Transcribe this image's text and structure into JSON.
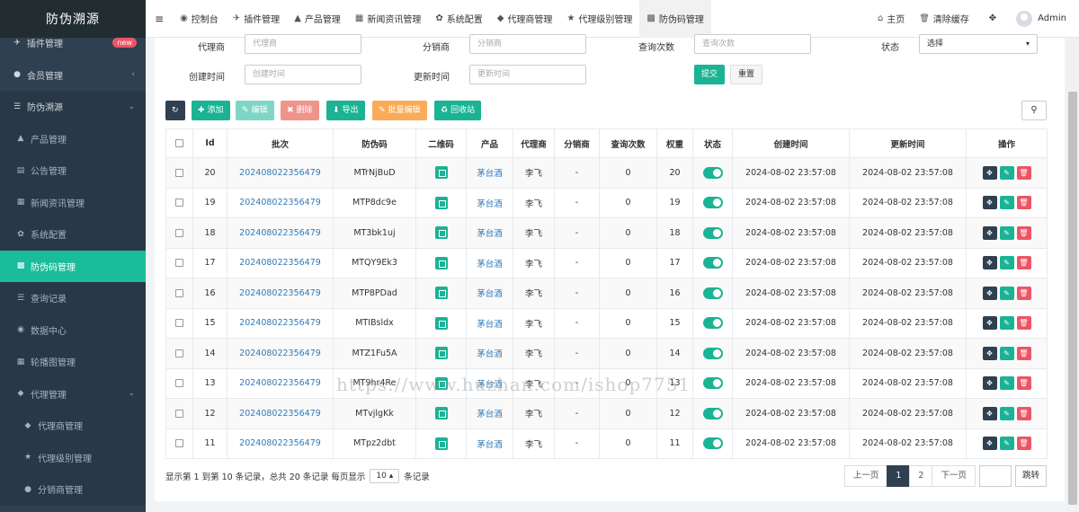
{
  "sidebar": {
    "logo": "防伪溯源",
    "items": [
      {
        "icon": "plugin-icon",
        "glyph": "✈",
        "label": "插件管理",
        "badge": "new",
        "kind": "top"
      },
      {
        "icon": "user-circle-icon",
        "glyph": "●",
        "label": "会员管理",
        "arrow": "‹",
        "kind": "top"
      },
      {
        "icon": "list-icon",
        "glyph": "☰",
        "label": "防伪溯源",
        "arrow": "⌄",
        "kind": "top-open"
      },
      {
        "icon": "building-icon",
        "glyph": "▲",
        "label": "产品管理",
        "kind": "sub"
      },
      {
        "icon": "file-icon",
        "glyph": "▤",
        "label": "公告管理",
        "kind": "sub"
      },
      {
        "icon": "newspaper-icon",
        "glyph": "▦",
        "label": "新闻资讯管理",
        "kind": "sub"
      },
      {
        "icon": "gear-icon",
        "glyph": "✿",
        "label": "系统配置",
        "kind": "sub"
      },
      {
        "icon": "barcode-icon",
        "glyph": "▩",
        "label": "防伪码管理",
        "kind": "sub-active"
      },
      {
        "icon": "list-icon",
        "glyph": "☰",
        "label": "查询记录",
        "kind": "sub"
      },
      {
        "icon": "dashboard-icon",
        "glyph": "◉",
        "label": "数据中心",
        "kind": "sub"
      },
      {
        "icon": "carousel-icon",
        "glyph": "▦",
        "label": "轮播图管理",
        "kind": "sub"
      },
      {
        "icon": "users-icon",
        "glyph": "◆",
        "label": "代理管理",
        "arrow": "⌄",
        "kind": "sub"
      },
      {
        "icon": "users-icon",
        "glyph": "◆",
        "label": "代理商管理",
        "kind": "sub2"
      },
      {
        "icon": "star-icon",
        "glyph": "★",
        "label": "代理级别管理",
        "kind": "sub2"
      },
      {
        "icon": "user-circle-icon",
        "glyph": "●",
        "label": "分销商管理",
        "kind": "sub2"
      }
    ]
  },
  "topnav": {
    "menu_icon": "≡",
    "tabs": [
      {
        "icon": "dashboard-icon",
        "glyph": "◉",
        "label": "控制台"
      },
      {
        "icon": "plugin-icon",
        "glyph": "✈",
        "label": "插件管理"
      },
      {
        "icon": "building-icon",
        "glyph": "▲",
        "label": "产品管理"
      },
      {
        "icon": "newspaper-icon",
        "glyph": "▦",
        "label": "新闻资讯管理"
      },
      {
        "icon": "gear-icon",
        "glyph": "✿",
        "label": "系统配置"
      },
      {
        "icon": "users-icon",
        "glyph": "◆",
        "label": "代理商管理"
      },
      {
        "icon": "star-icon",
        "glyph": "★",
        "label": "代理级别管理"
      },
      {
        "icon": "barcode-icon",
        "glyph": "▩",
        "label": "防伪码管理",
        "active": true
      }
    ],
    "home": {
      "glyph": "⌂",
      "label": "主页"
    },
    "clear_cache": {
      "glyph": "🗑",
      "label": "清除缓存"
    },
    "fullscreen_glyph": "✥",
    "user": "Admin"
  },
  "filters": {
    "agent": {
      "label": "代理商",
      "placeholder": "代理商"
    },
    "distributor": {
      "label": "分销商",
      "placeholder": "分销商"
    },
    "query_count": {
      "label": "查询次数",
      "placeholder": "查询次数"
    },
    "status": {
      "label": "状态",
      "value": "选择",
      "caret": "▾"
    },
    "created": {
      "label": "创建时间",
      "placeholder": "创建时间"
    },
    "updated": {
      "label": "更新时间",
      "placeholder": "更新时间"
    },
    "submit": "提交",
    "reset": "重置"
  },
  "toolbar": {
    "refresh_glyph": "↻",
    "add": "添加",
    "edit": "编辑",
    "delete": "删除",
    "export": "导出",
    "batch_edit": "批量编辑",
    "recycle": "回收站",
    "search_glyph": "⚲",
    "colors": {
      "refresh": "#2f4050",
      "add": "#1ab394",
      "edit": "#7fd6c6",
      "delete": "#f0938b",
      "export": "#1ab394",
      "batch_edit": "#f8ac59",
      "recycle": "#1ab394"
    }
  },
  "table": {
    "columns": [
      "Id",
      "批次",
      "防伪码",
      "二维码",
      "产品",
      "代理商",
      "分销商",
      "查询次数",
      "权重",
      "状态",
      "创建时间",
      "更新时间",
      "操作"
    ],
    "rows": [
      {
        "id": "20",
        "batch": "202408022356479",
        "code": "MTrNjBuD",
        "product": "茅台酒",
        "agent": "李飞",
        "distributor": "-",
        "queries": "0",
        "weight": "20",
        "created": "2024-08-02 23:57:08",
        "updated": "2024-08-02 23:57:08"
      },
      {
        "id": "19",
        "batch": "202408022356479",
        "code": "MTP8dc9e",
        "product": "茅台酒",
        "agent": "李飞",
        "distributor": "-",
        "queries": "0",
        "weight": "19",
        "created": "2024-08-02 23:57:08",
        "updated": "2024-08-02 23:57:08"
      },
      {
        "id": "18",
        "batch": "202408022356479",
        "code": "MT3bk1uj",
        "product": "茅台酒",
        "agent": "李飞",
        "distributor": "-",
        "queries": "0",
        "weight": "18",
        "created": "2024-08-02 23:57:08",
        "updated": "2024-08-02 23:57:08"
      },
      {
        "id": "17",
        "batch": "202408022356479",
        "code": "MTQY9Ek3",
        "product": "茅台酒",
        "agent": "李飞",
        "distributor": "-",
        "queries": "0",
        "weight": "17",
        "created": "2024-08-02 23:57:08",
        "updated": "2024-08-02 23:57:08"
      },
      {
        "id": "16",
        "batch": "202408022356479",
        "code": "MTP8PDad",
        "product": "茅台酒",
        "agent": "李飞",
        "distributor": "-",
        "queries": "0",
        "weight": "16",
        "created": "2024-08-02 23:57:08",
        "updated": "2024-08-02 23:57:08"
      },
      {
        "id": "15",
        "batch": "202408022356479",
        "code": "MTIBsldx",
        "product": "茅台酒",
        "agent": "李飞",
        "distributor": "-",
        "queries": "0",
        "weight": "15",
        "created": "2024-08-02 23:57:08",
        "updated": "2024-08-02 23:57:08"
      },
      {
        "id": "14",
        "batch": "202408022356479",
        "code": "MTZ1Fu5A",
        "product": "茅台酒",
        "agent": "李飞",
        "distributor": "-",
        "queries": "0",
        "weight": "14",
        "created": "2024-08-02 23:57:08",
        "updated": "2024-08-02 23:57:08"
      },
      {
        "id": "13",
        "batch": "202408022356479",
        "code": "MT9hr4Re",
        "product": "茅台酒",
        "agent": "李飞",
        "distributor": "-",
        "queries": "0",
        "weight": "13",
        "created": "2024-08-02 23:57:08",
        "updated": "2024-08-02 23:57:08"
      },
      {
        "id": "12",
        "batch": "202408022356479",
        "code": "MTvjlgKk",
        "product": "茅台酒",
        "agent": "李飞",
        "distributor": "-",
        "queries": "0",
        "weight": "12",
        "created": "2024-08-02 23:57:08",
        "updated": "2024-08-02 23:57:08"
      },
      {
        "id": "11",
        "batch": "202408022356479",
        "code": "MTpz2dbt",
        "product": "茅台酒",
        "agent": "李飞",
        "distributor": "-",
        "queries": "0",
        "weight": "11",
        "created": "2024-08-02 23:57:08",
        "updated": "2024-08-02 23:57:08"
      }
    ],
    "op_glyphs": {
      "drag": "✥",
      "edit": "✎",
      "delete": "🗑"
    },
    "op_colors": {
      "drag": "#2f4050",
      "edit": "#1ab394",
      "delete": "#ed5565"
    }
  },
  "footer": {
    "summary_prefix": "显示第 1 到第 10 条记录，总共 20 条记录 每页显示",
    "page_size": "10",
    "page_size_caret": "▴",
    "summary_suffix": "条记录",
    "prev": "上一页",
    "pages": [
      "1",
      "2"
    ],
    "current_page": "1",
    "next": "下一页",
    "jump": "跳转"
  },
  "watermark": "https://www.huzhan.com/ishop7751"
}
